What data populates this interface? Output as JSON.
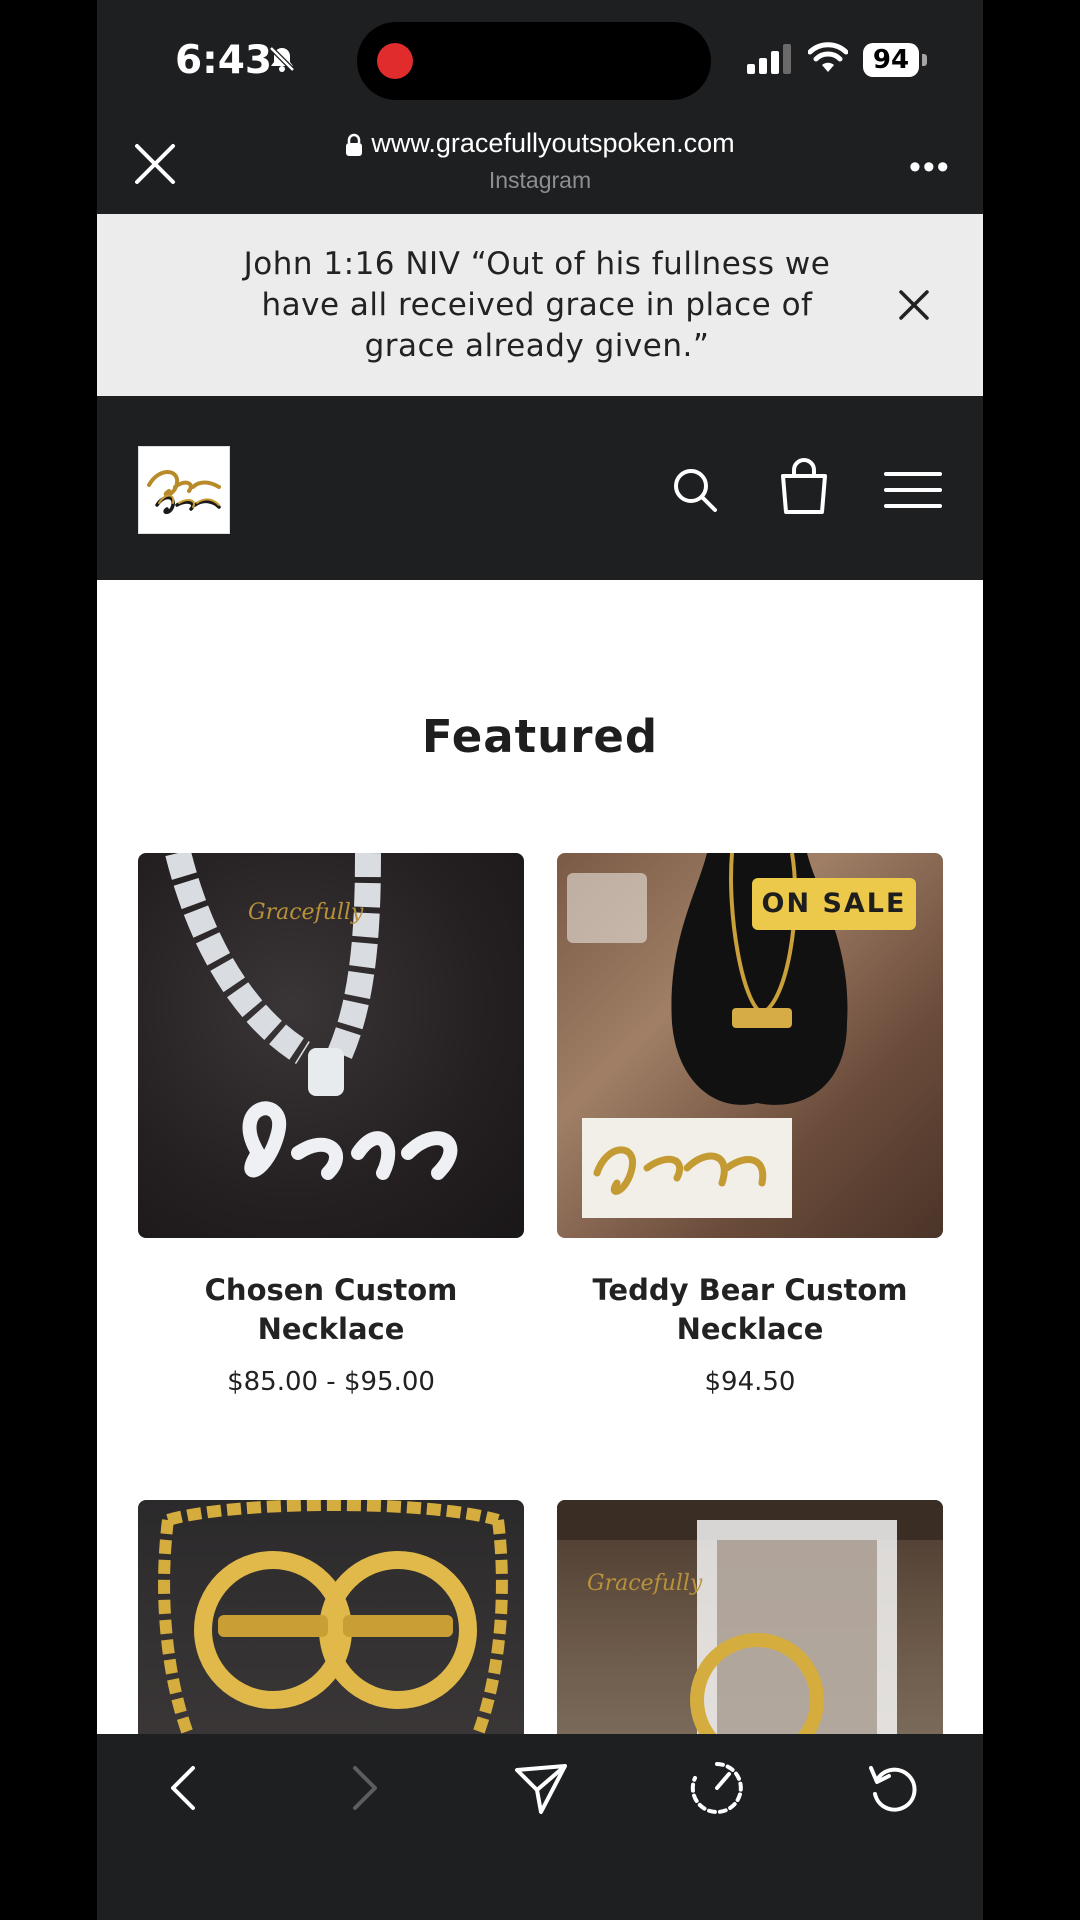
{
  "status_bar": {
    "time": "6:43",
    "battery": "94"
  },
  "browser": {
    "url": "www.gracefullyoutspoken.com",
    "source": "Instagram"
  },
  "announcement": {
    "text": "John 1:16 NIV “Out of his fullness we have all received grace in place of grace already given.”"
  },
  "section": {
    "title": "Featured"
  },
  "products": [
    {
      "title": "Chosen Custom Necklace",
      "price": "$85.00 - $95.00",
      "badge": ""
    },
    {
      "title": "Teddy Bear Custom Necklace",
      "price": "$94.50",
      "badge": "ON SALE"
    }
  ],
  "colors": {
    "accent_badge": "#ecc94b",
    "header_bg": "#1e1f21",
    "banner_bg": "#ececec",
    "record_dot": "#e02c2c"
  },
  "icons": [
    "bell-slash-icon",
    "signal-icon",
    "wifi-icon",
    "lock-icon",
    "close-icon",
    "more-icon",
    "search-icon",
    "bag-icon",
    "menu-icon",
    "back-icon",
    "forward-icon",
    "share-icon",
    "speed-icon",
    "reload-icon"
  ]
}
